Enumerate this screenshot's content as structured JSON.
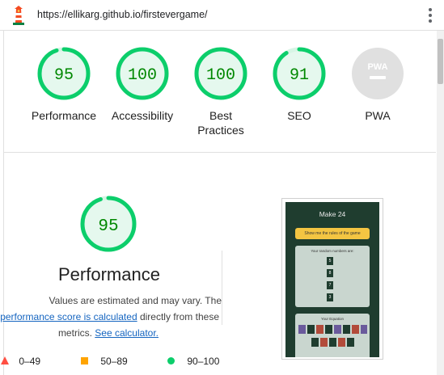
{
  "browser": {
    "url": "https://ellikarg.github.io/firstevergame/",
    "logo_icon": "lighthouse-icon",
    "menu_icon": "kebab-menu-icon"
  },
  "scores": [
    {
      "label": "Performance",
      "score": "95",
      "value": 95,
      "color": "#0cce6b"
    },
    {
      "label": "Accessibility",
      "score": "100",
      "value": 100,
      "color": "#0cce6b"
    },
    {
      "label": "Best Practices",
      "score": "100",
      "value": 100,
      "color": "#0cce6b"
    },
    {
      "label": "SEO",
      "score": "91",
      "value": 91,
      "color": "#0cce6b"
    },
    {
      "label": "PWA",
      "score": "",
      "value": null,
      "color": "#9e9e9e"
    }
  ],
  "pwa_badge": "PWA",
  "performance": {
    "score": "95",
    "value": 95,
    "title": "Performance",
    "desc_line1": "Values are estimated and may vary. The",
    "desc_link1": "performance score is calculated",
    "desc_line2_rest": " directly from these",
    "desc_line3": "metrics. ",
    "desc_link2": "See calculator."
  },
  "legend": {
    "fail": "0–49",
    "average": "50–89",
    "pass": "90–100",
    "colors": {
      "fail": "#ff4e42",
      "average": "#ffa400",
      "pass": "#0cce6b"
    }
  },
  "screenshot": {
    "title": "Make 24",
    "rules_button": "Show me the rules of the game",
    "numbers_caption": "Your random numbers are:",
    "numbers": [
      "5",
      "8",
      "7",
      "3"
    ],
    "equation_caption": "Your Equation"
  }
}
